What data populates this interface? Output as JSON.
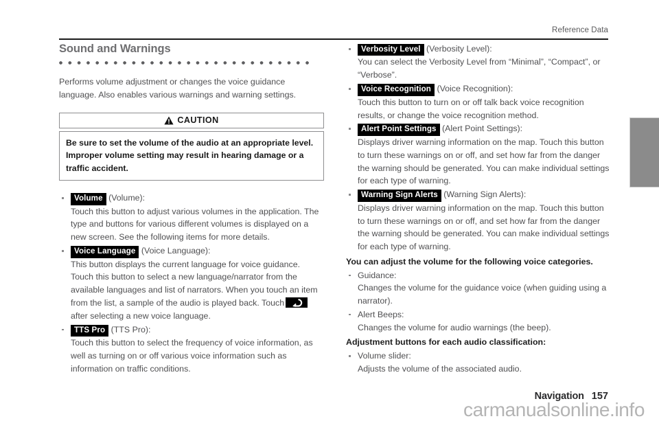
{
  "header": {
    "running_head": "Reference Data"
  },
  "footer": {
    "section_label": "Navigation",
    "page_number": "157",
    "watermark": "carmanualsonline.info"
  },
  "section": {
    "title": "Sound and Warnings",
    "intro": "Performs volume adjustment or changes the voice guidance language. Also enables various warnings and warning settings."
  },
  "caution": {
    "label": "CAUTION",
    "icon": "warning-triangle-icon",
    "text": "Be sure to set the volume of the audio at an appropriate level. Improper volume setting may result in hearing damage or a traffic accident."
  },
  "left_column": {
    "items": [
      {
        "chip": "Volume",
        "caption": "(Volume):",
        "desc": "Touch this button to adjust various volumes in the application. The type and buttons for various different volumes is displayed on a new screen. See the following items for more details."
      },
      {
        "chip": "Voice Language",
        "caption": "(Voice Language):",
        "desc_before": "This button displays the current language for voice guidance. Touch this button to select a new language/narrator from the available languages and list of narrators. When you touch an item from the list, a sample of the audio is played back. Touch",
        "inline_icon": "back-arrow-icon",
        "desc_after": "after selecting a new voice language."
      },
      {
        "chip": "TTS Pro",
        "caption": "(TTS Pro):",
        "desc": "Touch this button to select the frequency of voice information, as well as turning on or off various voice information such as information on traffic conditions."
      }
    ]
  },
  "right_column": {
    "items": [
      {
        "chip": "Verbosity Level",
        "caption": "(Verbosity Level):",
        "desc": "You can select the Verbosity Level from “Minimal”, “Compact”, or “Verbose”."
      },
      {
        "chip": "Voice Recognition",
        "caption": "(Voice Recognition):",
        "desc": "Touch this button to turn on or off talk back voice recognition results, or change the voice recognition method."
      },
      {
        "chip": "Alert Point Settings",
        "caption": "(Alert Point Settings):",
        "desc": "Displays driver warning information on the map. Touch this button to turn these warnings on or off, and set how far from the danger the warning should be generated. You can make individual settings for each type of warning."
      },
      {
        "chip": "Warning Sign Alerts",
        "caption": "(Warning Sign Alerts):",
        "desc": "Displays driver warning information on the map. Touch this button to turn these warnings on or off, and set how far from the danger the warning should be generated. You can make individual settings for each type of warning."
      }
    ],
    "volume_heading": "You can adjust the volume for the following voice categories.",
    "volume_items": [
      {
        "term": "Guidance:",
        "desc": "Changes the volume for the guidance voice (when guiding using a narrator)."
      },
      {
        "term": "Alert Beeps:",
        "desc": "Changes the volume for audio warnings (the beep)."
      }
    ],
    "adjust_heading": "Adjustment buttons for each audio classification:",
    "adjust_items": [
      {
        "term": "Volume slider:",
        "desc": "Adjusts the volume of the associated audio."
      }
    ]
  }
}
